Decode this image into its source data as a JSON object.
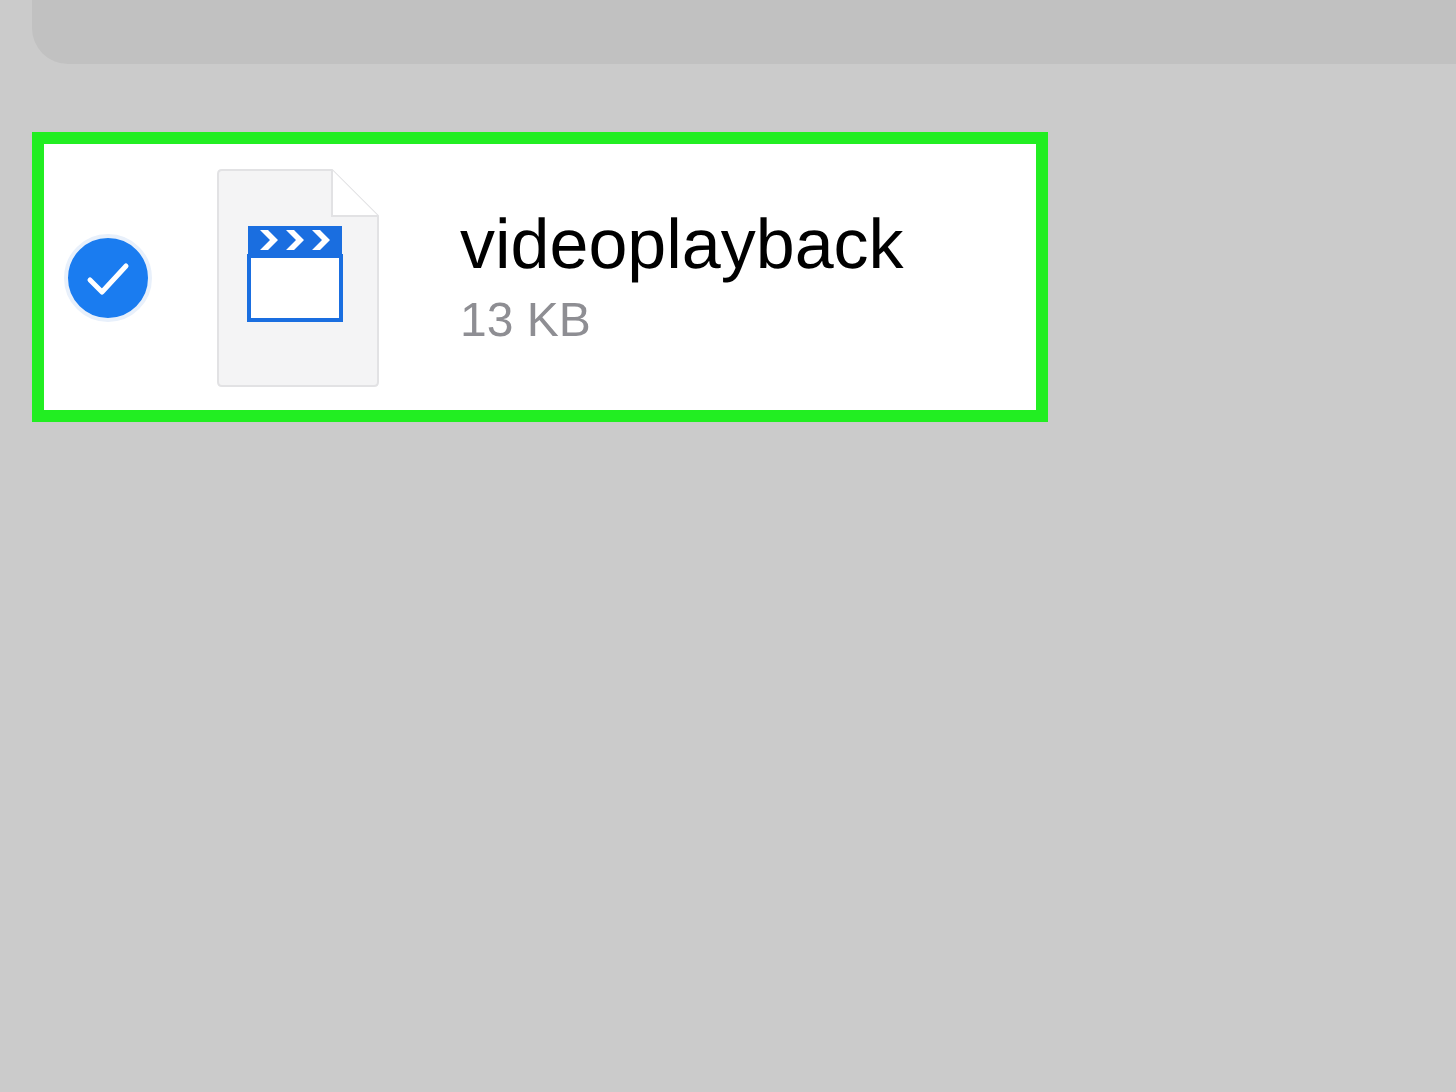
{
  "files": [
    {
      "name": "videoplayback",
      "size": "13 KB",
      "selected": true,
      "highlighted": true
    }
  ]
}
